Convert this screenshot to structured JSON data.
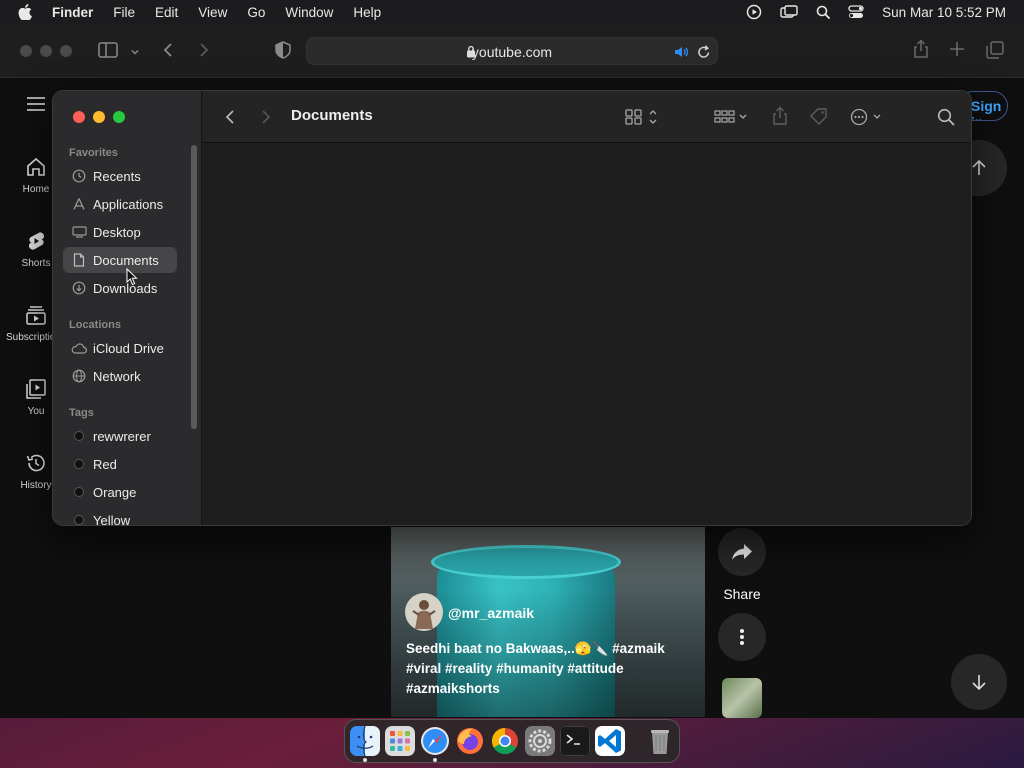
{
  "menubar": {
    "app": "Finder",
    "items": [
      "File",
      "Edit",
      "View",
      "Go",
      "Window",
      "Help"
    ],
    "datetime": "Sun Mar 10  5:52 PM"
  },
  "safari": {
    "url": "youtube.com"
  },
  "youtube": {
    "nav": [
      {
        "label": "Home",
        "icon": "home-icon"
      },
      {
        "label": "Shorts",
        "icon": "shorts-icon"
      },
      {
        "label": "Subscriptions",
        "icon": "subscriptions-icon"
      },
      {
        "label": "You",
        "icon": "you-icon"
      },
      {
        "label": "History",
        "icon": "history-icon"
      }
    ],
    "signin_label": "Sign in",
    "video": {
      "handle": "@mr_azmaik",
      "caption": "Seedhi baat no Bakwaas,..🫣🔪 #azmaik #viral #reality #humanity #attitude #azmaikshorts"
    },
    "share_label": "Share"
  },
  "finder": {
    "title": "Documents",
    "sections": {
      "favorites": "Favorites",
      "locations": "Locations",
      "tags": "Tags"
    },
    "favorites": [
      {
        "label": "Recents",
        "icon": "clock-icon"
      },
      {
        "label": "Applications",
        "icon": "applications-icon"
      },
      {
        "label": "Desktop",
        "icon": "desktop-icon"
      },
      {
        "label": "Documents",
        "icon": "document-icon",
        "selected": true
      },
      {
        "label": "Downloads",
        "icon": "download-icon"
      }
    ],
    "locations": [
      {
        "label": "iCloud Drive",
        "icon": "cloud-icon"
      },
      {
        "label": "Network",
        "icon": "globe-icon"
      }
    ],
    "tags": [
      "rewwrerer",
      "Red",
      "Orange",
      "Yellow"
    ]
  },
  "dock": {
    "apps": [
      "Finder",
      "Launchpad",
      "Safari",
      "Firefox",
      "Chrome",
      "System Settings",
      "Terminal",
      "Visual Studio Code",
      "Trash"
    ]
  }
}
